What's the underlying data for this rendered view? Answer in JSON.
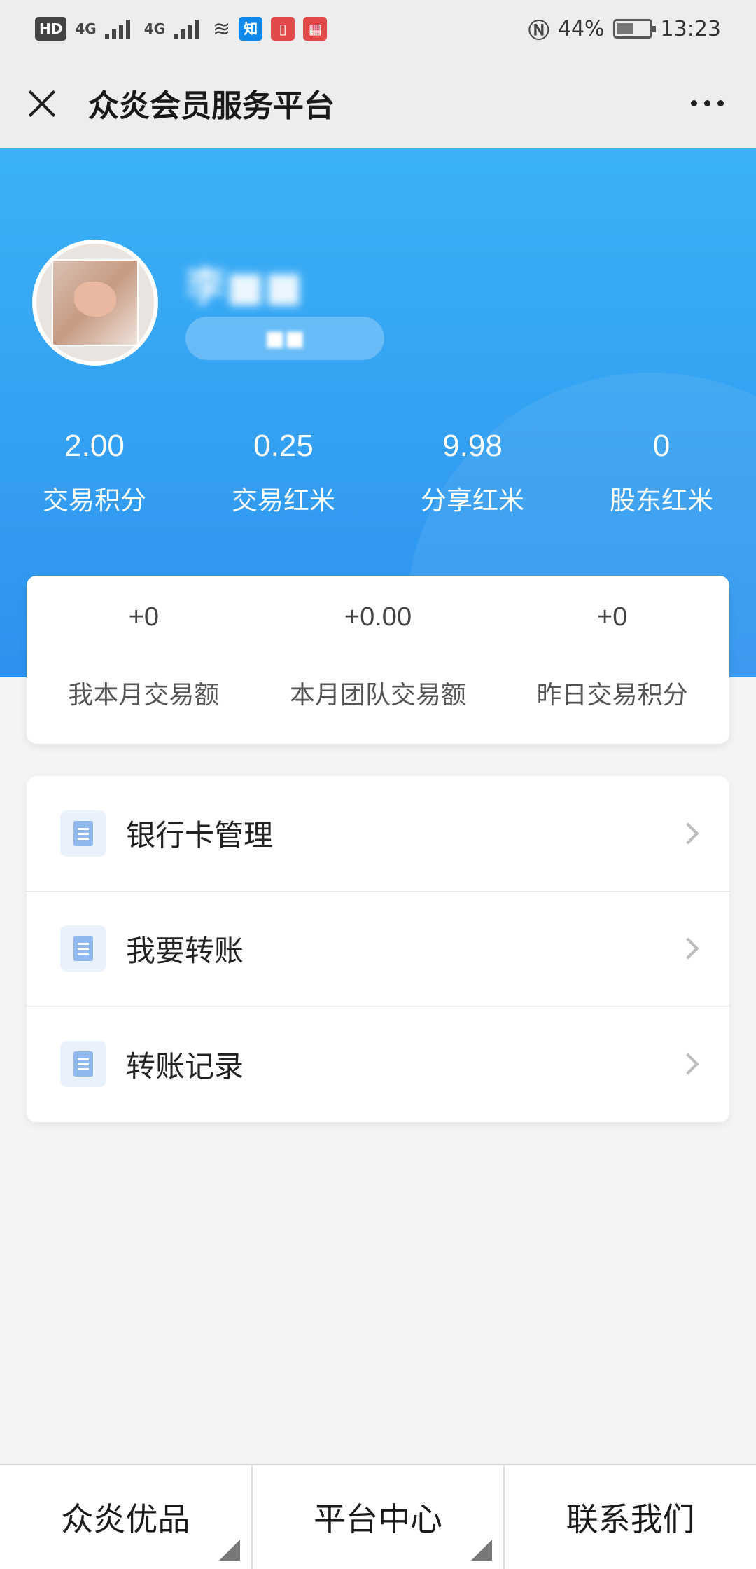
{
  "status_bar": {
    "hd_label": "HD",
    "net1": "4G",
    "net2": "4G",
    "zhihu_label": "知",
    "battery_percent": "44%",
    "time": "13:23"
  },
  "title_bar": {
    "title": "众炎会员服务平台"
  },
  "profile": {
    "name": "李■■",
    "badge": "■■"
  },
  "stats": [
    {
      "value": "2.00",
      "label": "交易积分"
    },
    {
      "value": "0.25",
      "label": "交易红米"
    },
    {
      "value": "9.98",
      "label": "分享红米"
    },
    {
      "value": "0",
      "label": "股东红米"
    }
  ],
  "monthly": [
    {
      "value": "+0",
      "label": "我本月交易额"
    },
    {
      "value": "+0.00",
      "label": "本月团队交易额"
    },
    {
      "value": "+0",
      "label": "昨日交易积分"
    }
  ],
  "menu": [
    {
      "label": "银行卡管理",
      "icon": "document-icon"
    },
    {
      "label": "我要转账",
      "icon": "document-icon"
    },
    {
      "label": "转账记录",
      "icon": "document-icon"
    }
  ],
  "bottom_nav": [
    {
      "label": "众炎优品"
    },
    {
      "label": "平台中心"
    },
    {
      "label": "联系我们"
    }
  ],
  "colors": {
    "hero_top": "#3bb1f7",
    "hero_bottom": "#2d92ee",
    "icon_bg": "#e8f1fc",
    "icon_fg": "#8fb8ef"
  }
}
